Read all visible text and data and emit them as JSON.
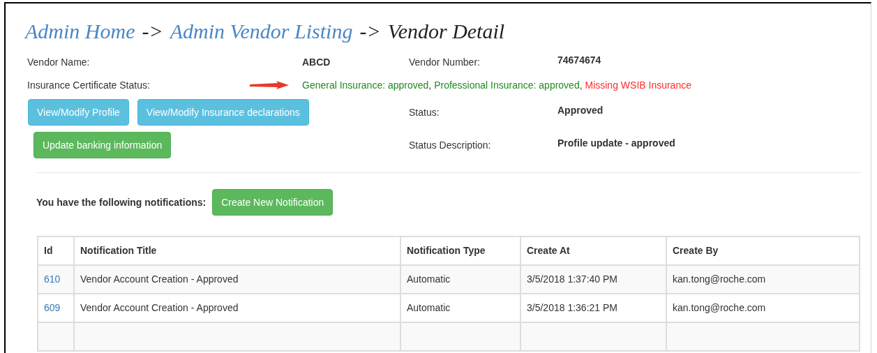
{
  "breadcrumb": [
    {
      "label": "Admin Home",
      "kind": "link"
    },
    {
      "label": "->",
      "kind": "separator"
    },
    {
      "label": "Admin Vendor Listing",
      "kind": "link"
    },
    {
      "label": "->",
      "kind": "separator"
    },
    {
      "label": "Vendor Detail",
      "kind": "current"
    }
  ],
  "vendor_name": {
    "label": "Vendor Name:",
    "value": "ABCD"
  },
  "vendor_number": {
    "label": "Vendor Number:",
    "value": "74674674"
  },
  "insurance": {
    "label": "Insurance Certificate Status:",
    "items": [
      {
        "text": "General Insurance: approved",
        "kind": "status",
        "color": "#1f8a1f"
      },
      {
        "text": ", ",
        "kind": "separator"
      },
      {
        "text": "Professional Insurance: approved",
        "kind": "status",
        "color": "#1f8a1f"
      },
      {
        "text": ", ",
        "kind": "separator"
      },
      {
        "text": "Missing WSIB Insurance",
        "kind": "status",
        "color": "#ff2a2a"
      }
    ]
  },
  "buttons": [
    {
      "label": "View/Modify Profile",
      "kind": "info"
    },
    {
      "label": "View/Modify Insurance declarations",
      "kind": "info"
    }
  ],
  "banking_button": {
    "label": "Update banking information",
    "kind": "success"
  },
  "status": {
    "label": "Status:",
    "value": "Approved"
  },
  "status_description": {
    "label": "Status Description:",
    "value": "Profile update - approved"
  },
  "notifications": {
    "label": "You have the following notifications:",
    "button": {
      "label": "Create New Notification",
      "kind": "success"
    }
  },
  "table": {
    "columns": [
      "Id",
      "Notification Title",
      "Notification Type",
      "Create At",
      "Create By"
    ],
    "rows": [
      [
        "610",
        "Vendor Account Creation - Approved",
        "Automatic",
        "3/5/2018 1:37:40 PM",
        "kan.tong@roche.com"
      ],
      [
        "609",
        "Vendor Account Creation - Approved",
        "Automatic",
        "3/5/2018 1:36:21 PM",
        "kan.tong@roche.com"
      ]
    ]
  }
}
